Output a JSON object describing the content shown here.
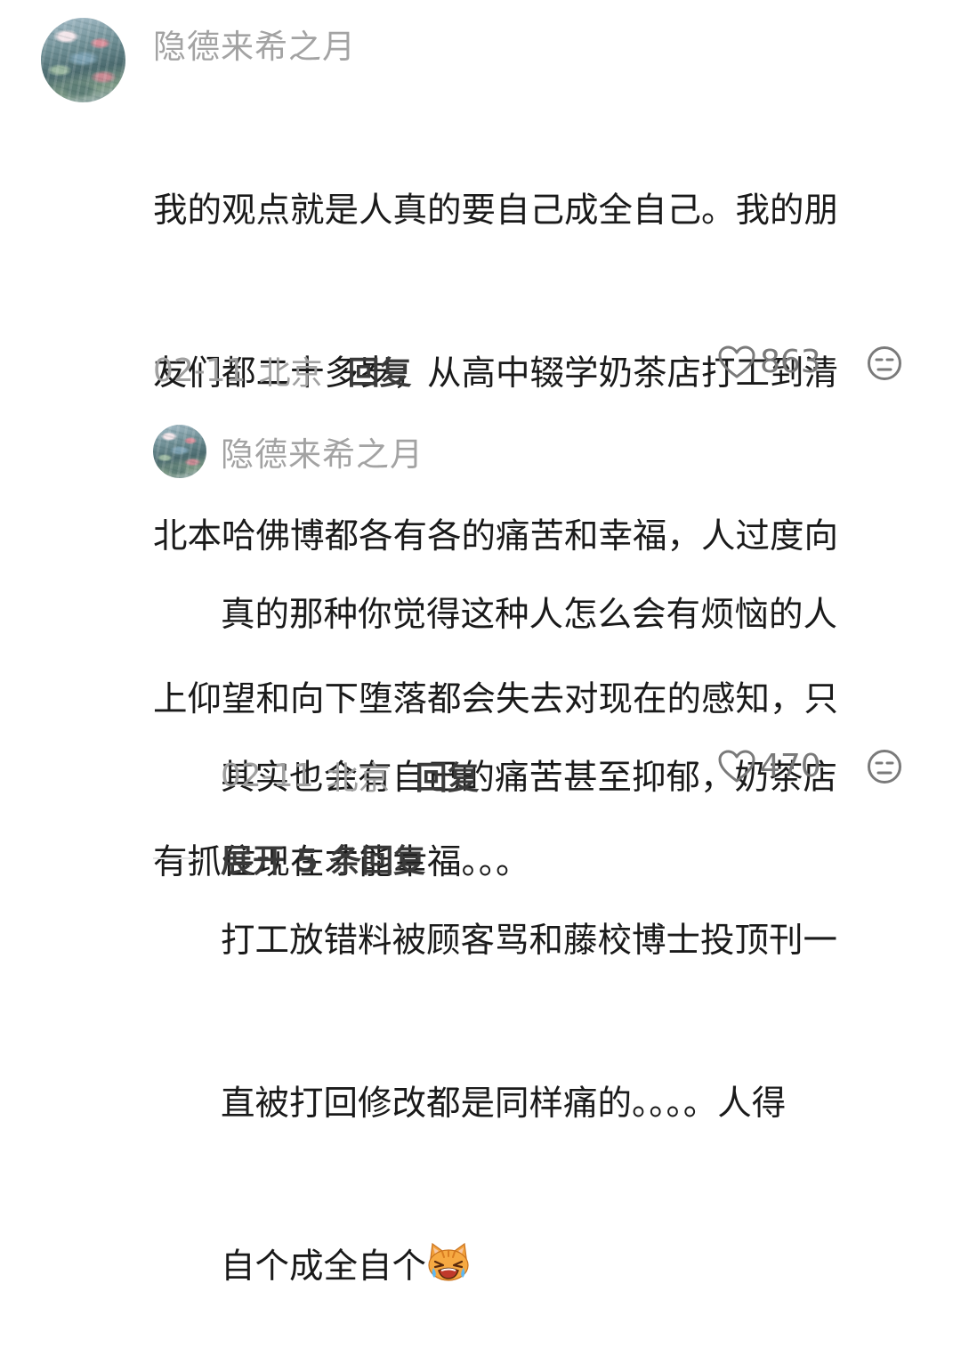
{
  "comment": {
    "username": "隐德来希之月",
    "lines": [
      "我的观点就是人真的要自己成全自己。我的朋",
      "友们都二十多岁，从高中辍学奶茶店打工到清",
      "北本哈佛博都各有各的痛苦和幸福，人过度向",
      "上仰望和向下堕落都会失去对现在的感知，只",
      "有抓住现在才能幸福。。。"
    ],
    "date": "02-11",
    "location": "北京",
    "reply_label": "回复",
    "like_count": "863",
    "icons": {
      "like": "heart-outline-icon",
      "dislike": "frown-face-icon"
    }
  },
  "reply": {
    "username": "隐德来希之月",
    "lines": [
      "真的那种你觉得这种人怎么会有烦恼的人",
      "其实也会有自己的痛苦甚至抑郁，奶茶店",
      "打工放错料被顾客骂和藤校博士投顶刊一",
      "直被打回修改都是同样痛的。。。。人得",
      "自个成全自个"
    ],
    "trailing_emoji": "crying-cat-emoji",
    "date": "02-11",
    "location": "北京",
    "reply_label": "回复",
    "like_count": "470"
  },
  "expand_replies": {
    "label": "展开 5 条回复"
  },
  "colors": {
    "text_primary": "#1a1a1a",
    "text_secondary": "#a0a0a0",
    "action_dark": "#3a3a3a"
  }
}
